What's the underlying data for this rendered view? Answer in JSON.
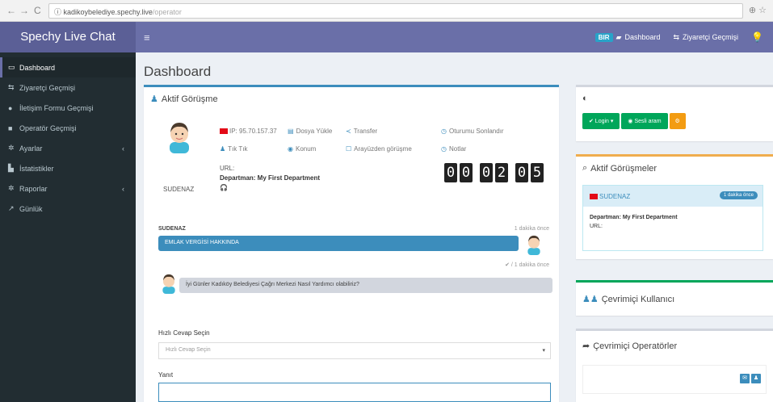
{
  "browser": {
    "back": "←",
    "forward": "→",
    "reload": "C",
    "url_host": "ⓘ kadikoybelediye.spechy.live",
    "url_path": "/operator",
    "right_icons": "⊕ ☆"
  },
  "topbar": {
    "brand": "Spechy Live Chat",
    "menu_toggle": "≡",
    "badge": "BIR",
    "dashboard": "Dashboard",
    "visitor_history": "Ziyaretçi Geçmişi",
    "bulb": "💡"
  },
  "sidebar": {
    "items": [
      {
        "icon": "▭",
        "label": "Dashboard"
      },
      {
        "icon": "⇆",
        "label": "Ziyaretçi Geçmişi"
      },
      {
        "icon": "●",
        "label": "İletişim Formu Geçmişi"
      },
      {
        "icon": "■",
        "label": "Operatör Geçmişi"
      },
      {
        "icon": "✲",
        "label": "Ayarlar",
        "chevron": "‹"
      },
      {
        "icon": "▙",
        "label": "İstatistikler"
      },
      {
        "icon": "✲",
        "label": "Raporlar",
        "chevron": "‹"
      },
      {
        "icon": "↗",
        "label": "Günlük"
      }
    ]
  },
  "page": {
    "title": "Dashboard"
  },
  "active_chat": {
    "title": "Aktif Görüşme",
    "visitor_name": "SUDENAZ",
    "ip": "IP: 95.70.157.37",
    "dosya_yukle": "Dosya Yükle",
    "transfer": "Transfer",
    "oturumu_sonlandir": "Oturumu Sonlandır",
    "tik_tik": "Tık Tık",
    "konum": "Konum",
    "arayuzden_gorusme": "Arayüzden görüşme",
    "notlar": "Notlar",
    "url": "URL:",
    "department": "Departman: My First Department",
    "headset": "🎧",
    "timer": [
      "0",
      "0",
      "0",
      "2",
      "0",
      "5"
    ]
  },
  "messages": {
    "sender": "SUDENAZ",
    "time1": "1 dakika önce",
    "text1": "EMLAK VERGİSİ HAKKINDA",
    "time2": "✔ / 1 dakika önce",
    "text2": "İyi Günler Kadıköy Belediyesi Çağrı Merkezi Nasıl Yardımcı olabiliriz?"
  },
  "quick_reply": {
    "label": "Hızlı Cevap Seçin",
    "placeholder": "Hızlı Cevap Seçin",
    "reply_label": "Yanıt"
  },
  "right": {
    "status_icon": "◐",
    "login_btn": "✔ Login ▾",
    "sesli_btn": "◉ Sesli aram",
    "gear_btn": "⚙",
    "active_sessions_title": "Aktif Görüşmeler",
    "session_visitor": "SUDENAZ",
    "session_pill": "1 dakika önce",
    "session_dept": "Departman: My First Department",
    "session_url": "URL:",
    "online_users_title": "Çevrimiçi Kullanıcı",
    "online_operators_title": "Çevrimiçi Operatörler"
  }
}
